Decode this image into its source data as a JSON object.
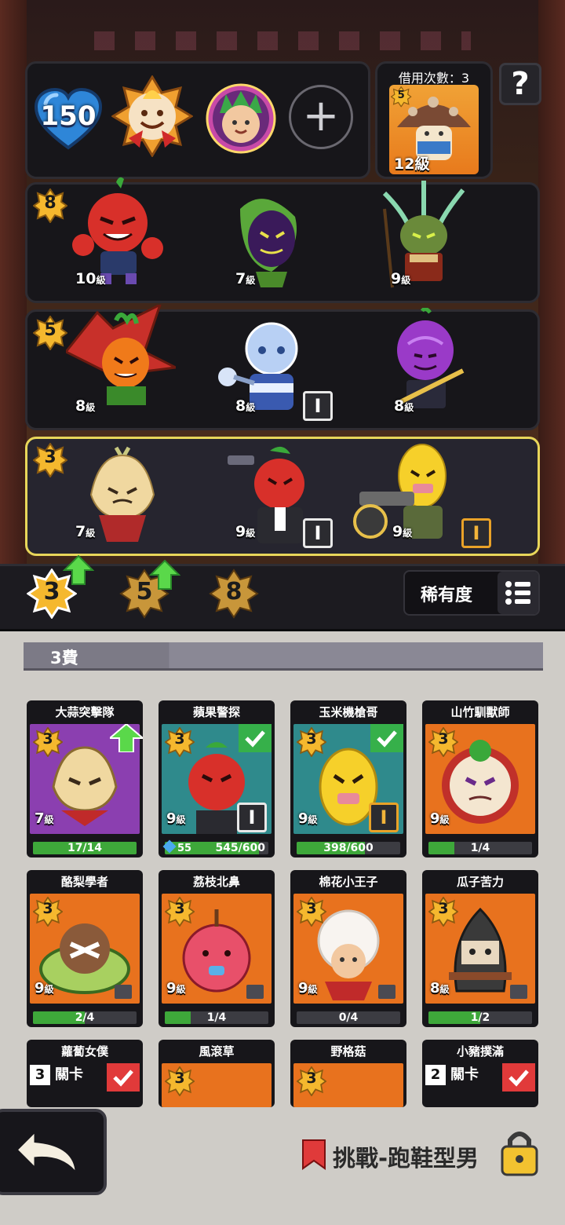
{
  "header": {
    "hearts": "150",
    "borrow_label": "借用次數：3",
    "borrow_card": {
      "cost": "5",
      "level": "12級"
    },
    "help_label": "?"
  },
  "team_rows": [
    {
      "cost": "8",
      "units": [
        {
          "level": "10",
          "unit": "級"
        },
        {
          "level": "7",
          "unit": "級"
        },
        {
          "level": "9",
          "unit": "級"
        }
      ]
    },
    {
      "cost": "5",
      "units": [
        {
          "level": "8",
          "unit": "級"
        },
        {
          "level": "8",
          "unit": "級",
          "item": "I"
        },
        {
          "level": "8",
          "unit": "級"
        }
      ]
    },
    {
      "cost": "3",
      "units": [
        {
          "level": "7",
          "unit": "級"
        },
        {
          "level": "9",
          "unit": "級",
          "item": "I"
        },
        {
          "level": "9",
          "unit": "級",
          "item": "I"
        }
      ]
    }
  ],
  "toolbar": {
    "tiers": [
      "3",
      "5",
      "8"
    ],
    "rarity_label": "稀有度"
  },
  "section": {
    "title": "3費"
  },
  "cards": [
    {
      "name": "大蒜突擊隊",
      "cost": "3",
      "level": "7",
      "progress": "17/14",
      "fill": 1.0,
      "bg": "#8b3fb0"
    },
    {
      "name": "蘋果警探",
      "cost": "3",
      "level": "9",
      "progress": "545/600",
      "fill": 0.91,
      "bg": "#2f8a8c",
      "gems": "55"
    },
    {
      "name": "玉米機槍哥",
      "cost": "3",
      "level": "9",
      "progress": "398/600",
      "fill": 0.66,
      "bg": "#2f8a8c"
    },
    {
      "name": "山竹馴獸師",
      "cost": "3",
      "level": "9",
      "progress": "1/4",
      "fill": 0.25,
      "bg": "#e8721e"
    },
    {
      "name": "酪梨學者",
      "cost": "3",
      "level": "9",
      "progress": "2/4",
      "fill": 0.5,
      "bg": "#e8721e"
    },
    {
      "name": "荔枝北鼻",
      "cost": "3",
      "level": "9",
      "progress": "1/4",
      "fill": 0.25,
      "bg": "#e8721e"
    },
    {
      "name": "棉花小王子",
      "cost": "3",
      "level": "9",
      "progress": "0/4",
      "fill": 0.0,
      "bg": "#e8721e"
    },
    {
      "name": "瓜子苦力",
      "cost": "3",
      "level": "8",
      "progress": "1/2",
      "fill": 0.5,
      "bg": "#e8721e"
    },
    {
      "name": "蘿蔔女僕",
      "stage": "3",
      "stage_label": "關卡"
    },
    {
      "name": "風滾草",
      "cost": "3"
    },
    {
      "name": "野格菇",
      "cost": "3"
    },
    {
      "name": "小豬撲滿",
      "stage": "2",
      "stage_label": "關卡"
    }
  ],
  "footer": {
    "challenge": "挑戰-跑鞋型男"
  }
}
